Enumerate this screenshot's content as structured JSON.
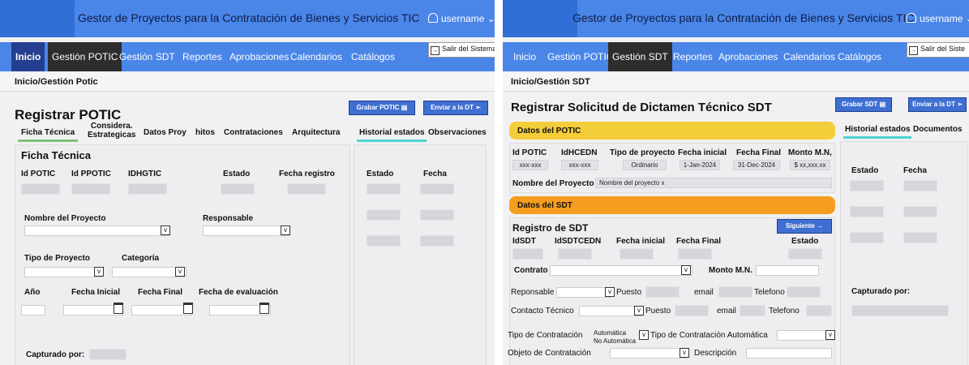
{
  "header": {
    "title": "Gestor de Proyectos para la Contratación de Bienes y Servicios TIC",
    "username": "username",
    "logout": "Salir del Sistema",
    "logout_short": "Salir del Siste"
  },
  "nav": {
    "items": [
      "Inicio",
      "Gestión POTIC",
      "Gestión SDT",
      "Reportes",
      "Aprobaciones",
      "Calendarios",
      "Catálogos"
    ]
  },
  "left": {
    "breadcrumb": "Inicio/Gestión Potic",
    "page_title": "Registrar POTIC",
    "btn_save": "Grabar POTIC",
    "btn_send": "Enviar a la DT",
    "tabs": [
      "Ficha Técnica",
      "Considera. Estrategicas",
      "Datos Proy",
      "hitos",
      "Contrataciones",
      "Arquitectura"
    ],
    "tab_consid_1": "Considera.",
    "tab_consid_2": "Estrategicas",
    "side_tabs": [
      "Historial estados",
      "Observaciones"
    ],
    "section_title": "Ficha Técnica",
    "fields_row1": [
      "Id POTIC",
      "Id PPOTIC",
      "IDHGTIC",
      "Estado",
      "Fecha registro"
    ],
    "nombre_label": "Nombre del Proyecto",
    "responsable_label": "Responsable",
    "tipo_label": "Tipo de Proyecto",
    "categoria_label": "Categoría",
    "fields_row4": [
      "Año",
      "Fecha Inicial",
      "Fecha Final",
      "Fecha de evaluación"
    ],
    "capturado": "Capturado por:",
    "hist_cols": [
      "Estado",
      "Fecha"
    ],
    "check_mark": "v"
  },
  "right": {
    "breadcrumb": "Inicio/Gestión SDT",
    "page_title": "Registrar Solicitud de Dictamen Técnico SDT",
    "btn_save": "Grabar SDT",
    "btn_send": "Enviar a la DT",
    "side_tabs": [
      "Historial estados",
      "Documentos"
    ],
    "potic_bar": "Datos del POTIC",
    "potic_cols": [
      "Id POTIC",
      "IdHCEDN",
      "Tipo de proyecto",
      "Fecha inicial",
      "Fecha Final",
      "Monto M.N,"
    ],
    "potic_vals": [
      "xxx-xxx",
      "xxx-xxx",
      "Ordinario",
      "1-Jan-2024",
      "31-Dec-2024",
      "$ xx,xxx.xx"
    ],
    "nombre_label": "Nombre del Proyecto",
    "nombre_val": "Nombre del proyecto x",
    "sdt_bar": "Datos del SDT",
    "registro_title": "Registro de SDT",
    "btn_next": "Siguiente →",
    "sdt_cols": [
      "IdSDT",
      "IdSDTCEDN",
      "Fecha inicial",
      "Fecha Final",
      "Estado"
    ],
    "contrato": "Contrato",
    "monto": "Monto M.N.",
    "reponsable": "Reponsable",
    "puesto": "Puesto",
    "email": "email",
    "telefono": "Telefono",
    "contacto": "Contacto Técnico",
    "tipo_contratacion": "Tipo de Contratación",
    "opt_auto": "Automática",
    "opt_no_auto": "No Automática",
    "tipo_auto": "Tipo de Contratación Automática",
    "objeto": "Objeto de Contratación",
    "descripcion": "Descripción",
    "hist_cols": [
      "Estado",
      "Fecha"
    ],
    "capturado": "Capturado por:",
    "check_mark": "v"
  },
  "colors": {
    "header_blue": "#4a86e8",
    "nav_active": "#243f8f",
    "accent_yellow": "#f4cd3a",
    "accent_orange": "#f59d1f",
    "tab_green": "#7cc47a",
    "tab_teal": "#4ed3cf"
  }
}
